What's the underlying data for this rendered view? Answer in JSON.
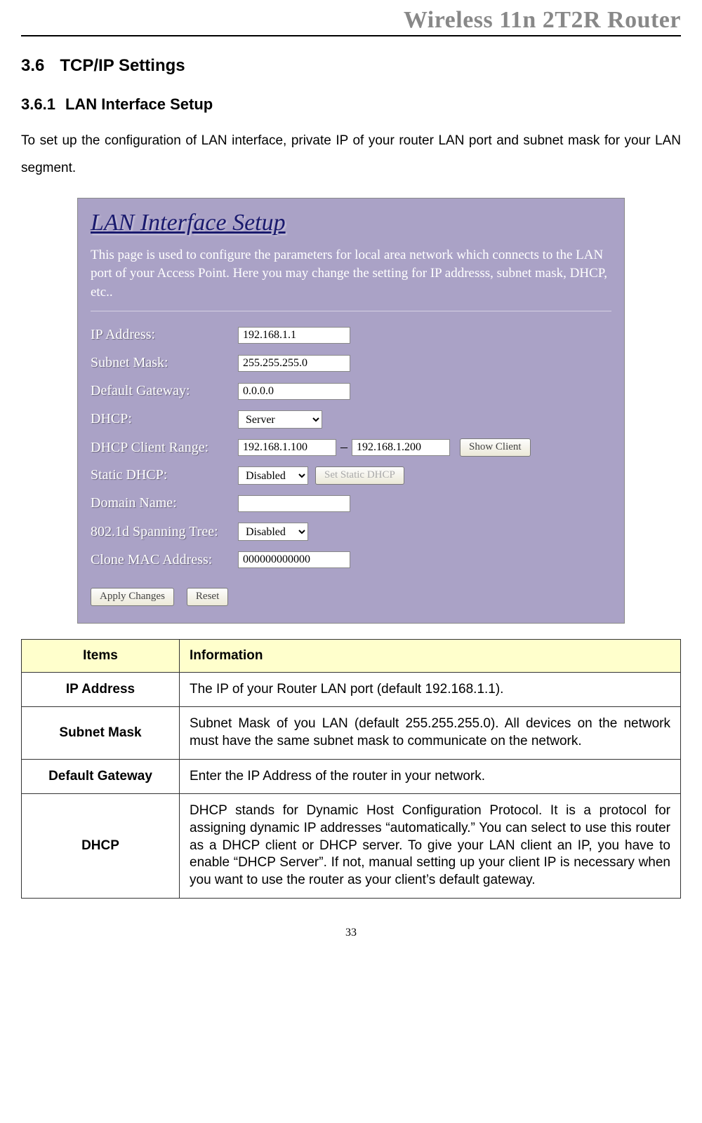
{
  "doc_header": "Wireless 11n 2T2R Router",
  "section": {
    "num": "3.6",
    "title": "TCP/IP Settings"
  },
  "subsection": {
    "num": "3.6.1",
    "title": "LAN Interface Setup"
  },
  "intro": "To set up the configuration of LAN interface, private IP of your router LAN port and subnet mask for your LAN segment.",
  "panel": {
    "title": "LAN Interface Setup",
    "desc": "This page is used to configure the parameters for local area network which connects to the LAN port of your Access Point. Here you may change the setting for IP addresss, subnet mask, DHCP, etc..",
    "labels": {
      "ip": "IP Address:",
      "mask": "Subnet Mask:",
      "gw": "Default Gateway:",
      "dhcp": "DHCP:",
      "range": "DHCP Client Range:",
      "static": "Static DHCP:",
      "domain": "Domain Name:",
      "spanning": "802.1d Spanning Tree:",
      "clone": "Clone MAC Address:"
    },
    "values": {
      "ip": "192.168.1.1",
      "mask": "255.255.255.0",
      "gw": "0.0.0.0",
      "dhcp": "Server",
      "range_start": "192.168.1.100",
      "range_end": "192.168.1.200",
      "static": "Disabled",
      "domain": "",
      "spanning": "Disabled",
      "clone": "000000000000"
    },
    "buttons": {
      "show_client": "Show Client",
      "set_static": "Set Static DHCP",
      "apply": "Apply Changes",
      "reset": "Reset"
    }
  },
  "info_table": {
    "headers": {
      "item": "Items",
      "info": "Information"
    },
    "rows": [
      {
        "item": "IP Address",
        "info": "The IP of your Router LAN port (default 192.168.1.1)."
      },
      {
        "item": "Subnet Mask",
        "info": "Subnet Mask of you LAN (default 255.255.255.0). All devices on the network must have the same subnet mask to communicate on the network."
      },
      {
        "item": "Default Gateway",
        "info": "Enter the IP Address of the router in your network."
      },
      {
        "item": "DHCP",
        "info": "DHCP stands for Dynamic Host Configuration Protocol. It is a protocol for assigning dynamic IP addresses “automatically.” You can select to use this router as a DHCP client or DHCP server. To give your LAN client an IP, you have to enable “DHCP Server”. If not, manual setting up your client IP is necessary when you want to use the router as your client’s default gateway."
      }
    ]
  },
  "page_number": "33"
}
